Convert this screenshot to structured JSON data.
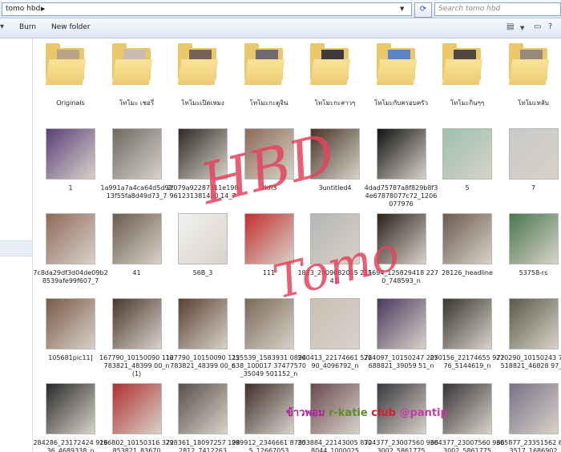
{
  "address": {
    "path": "tomo hbd",
    "search_placeholder": "Search tomo hbd"
  },
  "toolbar": {
    "burn": "Burn",
    "new_folder": "New folder"
  },
  "items": [
    {
      "label": "Originals",
      "folder": true,
      "color": "#b9a486"
    },
    {
      "label": "โทโมะ เชอรี่",
      "folder": true,
      "color": "#cbbab0"
    },
    {
      "label": "โทโมะเปิดเหมง",
      "folder": true,
      "color": "#776258"
    },
    {
      "label": "โทโมะกะตูจิน",
      "folder": true,
      "color": "#6f6a72"
    },
    {
      "label": "โทโมะกะสาวๆ",
      "folder": true,
      "color": "#3e3a3e"
    },
    {
      "label": "โทโมะกับครอบครัว",
      "folder": true,
      "color": "#5a86c7"
    },
    {
      "label": "โทโมะกินๆๆ",
      "folder": true,
      "color": "#4f4843"
    },
    {
      "label": "โทโมะหลับ",
      "folder": true,
      "color": "#988a7a"
    },
    {
      "label": "1",
      "color": "#5b3f78"
    },
    {
      "label": "1a991a7a4ca64d5d9213f55fa8d49d73_7",
      "color": "#6d6a5e"
    },
    {
      "label": "2f079a92287311e198961231381420 14_7",
      "color": "#2e2a24"
    },
    {
      "label": "2kfl3",
      "color": "#8a6b58"
    },
    {
      "label": "3untitled4",
      "color": "#463528"
    },
    {
      "label": "4dad75787a8f829b8f34e67878077c72_1206077976",
      "color": "#111111"
    },
    {
      "label": "5",
      "color": "#9bc1a8"
    },
    {
      "label": "7",
      "color": "#c9c9c9"
    },
    {
      "label": "7c8da29df3d04de09b28539afe99f607_7",
      "color": "#8f6a5c"
    },
    {
      "label": "41",
      "color": "#6a5b51"
    },
    {
      "label": "56B_3",
      "color": "#f2f2f2"
    },
    {
      "label": "111",
      "color": "#c33030"
    },
    {
      "label": "1813_2009082015 21141.",
      "color": "#b5b5b5"
    },
    {
      "label": "15694_125829418 2270_748593_n",
      "color": "#2c2018"
    },
    {
      "label": "28126_headline",
      "color": "#6b5a50"
    },
    {
      "label": "53758-rs",
      "color": "#4a7850"
    },
    {
      "label": "105681pic11]",
      "color": "#7a5a48"
    },
    {
      "label": "167790_10150090 112783821_48399 00_n (1)",
      "color": "#4a3830"
    },
    {
      "label": "167790_10150090 112783821_48399 00_n",
      "color": "#5a4032"
    },
    {
      "label": "255539_1583931 0894638_100017 37477570_35049 501152_n",
      "color": "#7a6a58"
    },
    {
      "label": "260413_22174661 57290_4096792_n",
      "color": "#c9c0b5"
    },
    {
      "label": "264097_10150247 205688821_39059 51_n",
      "color": "#4a3a60"
    },
    {
      "label": "270156_22174655 97276_5144619_n",
      "color": "#3a3530"
    },
    {
      "label": "270290_10150243 772518821_46828 97_n",
      "color": "#5a5a48"
    },
    {
      "label": "284286_23172424 91636_4689338_n",
      "color": "#2a2a2a"
    },
    {
      "label": "296802_10150316 372853821_83670",
      "color": "#b03030"
    },
    {
      "label": "298361_18097257 1982812_7412263",
      "color": "#5a5048"
    },
    {
      "label": "299912_2346661 87855_12667053",
      "color": "#403028"
    },
    {
      "label": "303884_22143005 8728044_1000025",
      "color": "#6a4a50"
    },
    {
      "label": "304377_23007560 9663002_5861775",
      "color": "#3a3840"
    },
    {
      "label": "304377_23007560 9663002_5861775",
      "color": "#383438"
    },
    {
      "label": "305877_23351562 6583517_1686902",
      "color": "#7a7088"
    }
  ],
  "watermark": {
    "line1": "HBD",
    "line2": "Tomo"
  },
  "banner": {
    "part1": "ข้าวพอม",
    "part2": "r-katie",
    "part3": "club",
    "part4": "@pantip"
  }
}
